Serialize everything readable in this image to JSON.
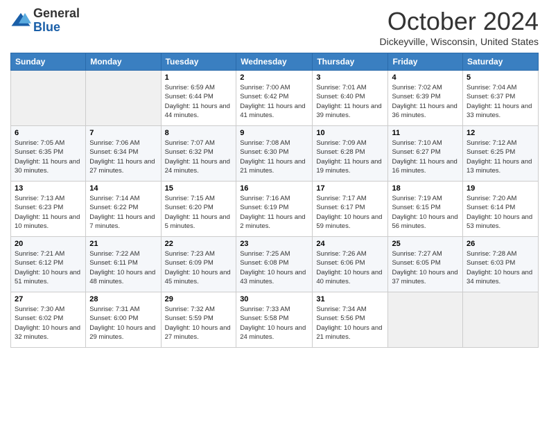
{
  "logo": {
    "line1": "General",
    "line2": "Blue"
  },
  "header": {
    "month_title": "October 2024",
    "subtitle": "Dickeyville, Wisconsin, United States"
  },
  "days_of_week": [
    "Sunday",
    "Monday",
    "Tuesday",
    "Wednesday",
    "Thursday",
    "Friday",
    "Saturday"
  ],
  "weeks": [
    [
      {
        "day": "",
        "info": ""
      },
      {
        "day": "",
        "info": ""
      },
      {
        "day": "1",
        "info": "Sunrise: 6:59 AM\nSunset: 6:44 PM\nDaylight: 11 hours and 44 minutes."
      },
      {
        "day": "2",
        "info": "Sunrise: 7:00 AM\nSunset: 6:42 PM\nDaylight: 11 hours and 41 minutes."
      },
      {
        "day": "3",
        "info": "Sunrise: 7:01 AM\nSunset: 6:40 PM\nDaylight: 11 hours and 39 minutes."
      },
      {
        "day": "4",
        "info": "Sunrise: 7:02 AM\nSunset: 6:39 PM\nDaylight: 11 hours and 36 minutes."
      },
      {
        "day": "5",
        "info": "Sunrise: 7:04 AM\nSunset: 6:37 PM\nDaylight: 11 hours and 33 minutes."
      }
    ],
    [
      {
        "day": "6",
        "info": "Sunrise: 7:05 AM\nSunset: 6:35 PM\nDaylight: 11 hours and 30 minutes."
      },
      {
        "day": "7",
        "info": "Sunrise: 7:06 AM\nSunset: 6:34 PM\nDaylight: 11 hours and 27 minutes."
      },
      {
        "day": "8",
        "info": "Sunrise: 7:07 AM\nSunset: 6:32 PM\nDaylight: 11 hours and 24 minutes."
      },
      {
        "day": "9",
        "info": "Sunrise: 7:08 AM\nSunset: 6:30 PM\nDaylight: 11 hours and 21 minutes."
      },
      {
        "day": "10",
        "info": "Sunrise: 7:09 AM\nSunset: 6:28 PM\nDaylight: 11 hours and 19 minutes."
      },
      {
        "day": "11",
        "info": "Sunrise: 7:10 AM\nSunset: 6:27 PM\nDaylight: 11 hours and 16 minutes."
      },
      {
        "day": "12",
        "info": "Sunrise: 7:12 AM\nSunset: 6:25 PM\nDaylight: 11 hours and 13 minutes."
      }
    ],
    [
      {
        "day": "13",
        "info": "Sunrise: 7:13 AM\nSunset: 6:23 PM\nDaylight: 11 hours and 10 minutes."
      },
      {
        "day": "14",
        "info": "Sunrise: 7:14 AM\nSunset: 6:22 PM\nDaylight: 11 hours and 7 minutes."
      },
      {
        "day": "15",
        "info": "Sunrise: 7:15 AM\nSunset: 6:20 PM\nDaylight: 11 hours and 5 minutes."
      },
      {
        "day": "16",
        "info": "Sunrise: 7:16 AM\nSunset: 6:19 PM\nDaylight: 11 hours and 2 minutes."
      },
      {
        "day": "17",
        "info": "Sunrise: 7:17 AM\nSunset: 6:17 PM\nDaylight: 10 hours and 59 minutes."
      },
      {
        "day": "18",
        "info": "Sunrise: 7:19 AM\nSunset: 6:15 PM\nDaylight: 10 hours and 56 minutes."
      },
      {
        "day": "19",
        "info": "Sunrise: 7:20 AM\nSunset: 6:14 PM\nDaylight: 10 hours and 53 minutes."
      }
    ],
    [
      {
        "day": "20",
        "info": "Sunrise: 7:21 AM\nSunset: 6:12 PM\nDaylight: 10 hours and 51 minutes."
      },
      {
        "day": "21",
        "info": "Sunrise: 7:22 AM\nSunset: 6:11 PM\nDaylight: 10 hours and 48 minutes."
      },
      {
        "day": "22",
        "info": "Sunrise: 7:23 AM\nSunset: 6:09 PM\nDaylight: 10 hours and 45 minutes."
      },
      {
        "day": "23",
        "info": "Sunrise: 7:25 AM\nSunset: 6:08 PM\nDaylight: 10 hours and 43 minutes."
      },
      {
        "day": "24",
        "info": "Sunrise: 7:26 AM\nSunset: 6:06 PM\nDaylight: 10 hours and 40 minutes."
      },
      {
        "day": "25",
        "info": "Sunrise: 7:27 AM\nSunset: 6:05 PM\nDaylight: 10 hours and 37 minutes."
      },
      {
        "day": "26",
        "info": "Sunrise: 7:28 AM\nSunset: 6:03 PM\nDaylight: 10 hours and 34 minutes."
      }
    ],
    [
      {
        "day": "27",
        "info": "Sunrise: 7:30 AM\nSunset: 6:02 PM\nDaylight: 10 hours and 32 minutes."
      },
      {
        "day": "28",
        "info": "Sunrise: 7:31 AM\nSunset: 6:00 PM\nDaylight: 10 hours and 29 minutes."
      },
      {
        "day": "29",
        "info": "Sunrise: 7:32 AM\nSunset: 5:59 PM\nDaylight: 10 hours and 27 minutes."
      },
      {
        "day": "30",
        "info": "Sunrise: 7:33 AM\nSunset: 5:58 PM\nDaylight: 10 hours and 24 minutes."
      },
      {
        "day": "31",
        "info": "Sunrise: 7:34 AM\nSunset: 5:56 PM\nDaylight: 10 hours and 21 minutes."
      },
      {
        "day": "",
        "info": ""
      },
      {
        "day": "",
        "info": ""
      }
    ]
  ]
}
